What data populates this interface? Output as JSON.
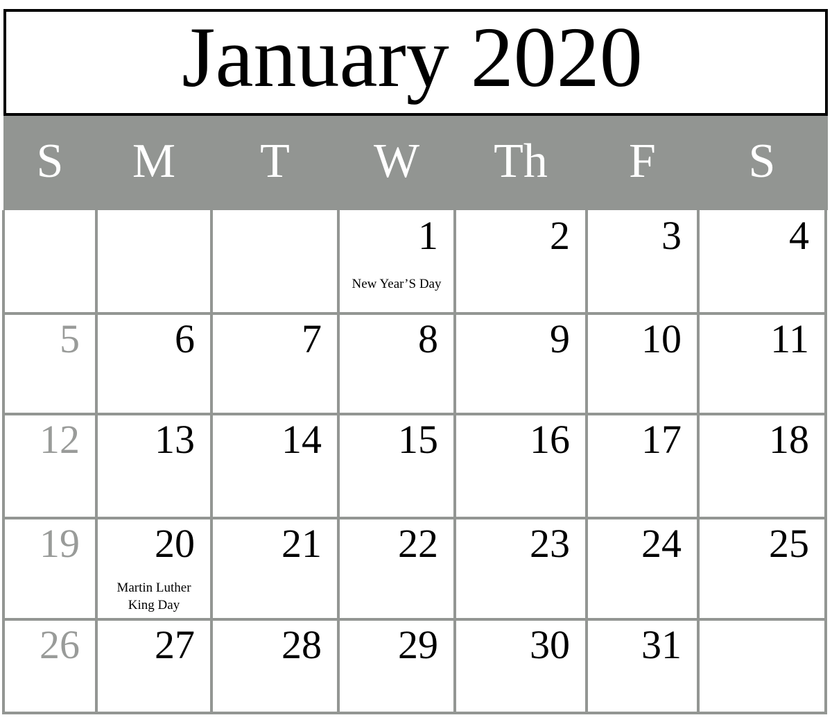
{
  "title": "January 2020",
  "colors": {
    "header_band": "#929592",
    "grid_line": "#939693",
    "weekend_sunday_number": "#999b99",
    "number": "#000000",
    "title_border": "#000000"
  },
  "weekdays": [
    "S",
    "M",
    "T",
    "W",
    "Th",
    "F",
    "S"
  ],
  "weeks": [
    [
      {
        "day": "",
        "holiday": ""
      },
      {
        "day": "",
        "holiday": ""
      },
      {
        "day": "",
        "holiday": ""
      },
      {
        "day": "1",
        "holiday": "New Year’S Day"
      },
      {
        "day": "2",
        "holiday": ""
      },
      {
        "day": "3",
        "holiday": ""
      },
      {
        "day": "4",
        "holiday": ""
      }
    ],
    [
      {
        "day": "5",
        "holiday": ""
      },
      {
        "day": "6",
        "holiday": ""
      },
      {
        "day": "7",
        "holiday": ""
      },
      {
        "day": "8",
        "holiday": ""
      },
      {
        "day": "9",
        "holiday": ""
      },
      {
        "day": "10",
        "holiday": ""
      },
      {
        "day": "11",
        "holiday": ""
      }
    ],
    [
      {
        "day": "12",
        "holiday": ""
      },
      {
        "day": "13",
        "holiday": ""
      },
      {
        "day": "14",
        "holiday": ""
      },
      {
        "day": "15",
        "holiday": ""
      },
      {
        "day": "16",
        "holiday": ""
      },
      {
        "day": "17",
        "holiday": ""
      },
      {
        "day": "18",
        "holiday": ""
      }
    ],
    [
      {
        "day": "19",
        "holiday": ""
      },
      {
        "day": "20",
        "holiday": "Martin Luther\nKing Day"
      },
      {
        "day": "21",
        "holiday": ""
      },
      {
        "day": "22",
        "holiday": ""
      },
      {
        "day": "23",
        "holiday": ""
      },
      {
        "day": "24",
        "holiday": ""
      },
      {
        "day": "25",
        "holiday": ""
      }
    ],
    [
      {
        "day": "26",
        "holiday": ""
      },
      {
        "day": "27",
        "holiday": ""
      },
      {
        "day": "28",
        "holiday": ""
      },
      {
        "day": "29",
        "holiday": ""
      },
      {
        "day": "30",
        "holiday": ""
      },
      {
        "day": "31",
        "holiday": ""
      },
      {
        "day": "",
        "holiday": ""
      }
    ]
  ]
}
